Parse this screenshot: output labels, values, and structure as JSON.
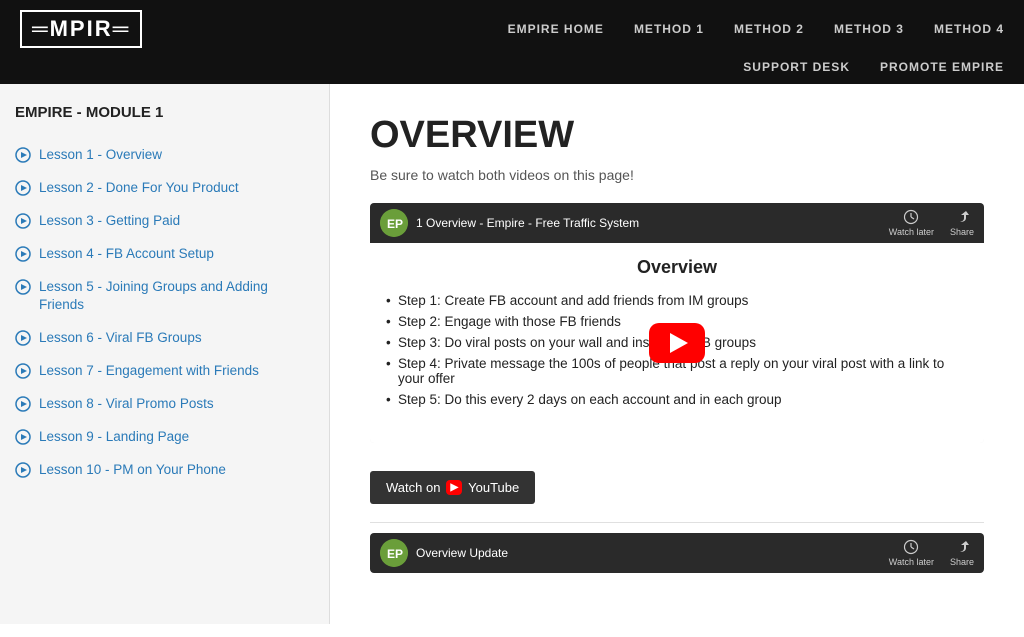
{
  "nav": {
    "logo": "=MPIR=",
    "links_top": [
      "EMPIRE HOME",
      "METHOD 1",
      "METHOD 2",
      "METHOD 3",
      "METHOD 4"
    ],
    "links_bottom": [
      "SUPPORT DESK",
      "PROMOTE EMPIRE"
    ]
  },
  "sidebar": {
    "title": "EMPIRE - MODULE 1",
    "lessons": [
      {
        "id": 1,
        "label": "Lesson 1 - Overview"
      },
      {
        "id": 2,
        "label": "Lesson 2 - Done For You Product"
      },
      {
        "id": 3,
        "label": "Lesson 3 - Getting Paid"
      },
      {
        "id": 4,
        "label": "Lesson 4 - FB Account Setup"
      },
      {
        "id": 5,
        "label": "Lesson 5 - Joining Groups and Adding Friends"
      },
      {
        "id": 6,
        "label": "Lesson 6 - Viral FB Groups"
      },
      {
        "id": 7,
        "label": "Lesson 7 - Engagement with Friends"
      },
      {
        "id": 8,
        "label": "Lesson 8 - Viral Promo Posts"
      },
      {
        "id": 9,
        "label": "Lesson 9 - Landing Page"
      },
      {
        "id": 10,
        "label": "Lesson 10 - PM on Your Phone"
      }
    ]
  },
  "main": {
    "title": "OVERVIEW",
    "subtitle": "Be sure to watch both videos on this page!",
    "video1": {
      "title": "1 Overview - Empire - Free Traffic System",
      "body_title": "Overview",
      "steps": [
        "Step 1: Create FB account and add friends from IM groups",
        "Step 2: Engage with those FB friends",
        "Step 3: Do viral posts on your wall and inside the FB groups",
        "Step 4: Private message the 100s of people that post a reply on your viral post with a link to your offer",
        "Step 5: Do this every 2 days on each account and in each group"
      ],
      "watch_label": "Watch on",
      "yt_label": "YouTube"
    },
    "video2": {
      "title": "Overview Update"
    }
  },
  "icons": {
    "clock": "🕐",
    "share": "↗"
  }
}
